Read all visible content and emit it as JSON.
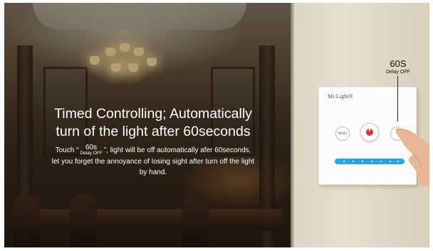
{
  "headline": {
    "line1": "Timed Controlling; Automatically",
    "line2": "turn of the light after 60seconds"
  },
  "description": {
    "prefix": "Touch “",
    "badge_value": "60s",
    "badge_label": "Delay OFF",
    "suffix": "”, light will be off automatically afer 60seconds,",
    "line2": "let you forget the annoyance of losing sight after turn off the light",
    "line3": "by hand."
  },
  "panel": {
    "brand": "Mi·Light®",
    "mode_label": "Mode"
  },
  "callout": {
    "value": "60S",
    "label": "Delay OFF"
  },
  "colors": {
    "power_button": "#e03030",
    "slider": "#29a6df",
    "text_overlay": "#ffffff"
  },
  "icons": [
    "power-icon",
    "mode-button-icon",
    "delay-button-icon",
    "brightness-slider-icon",
    "hand-pointer-icon"
  ]
}
